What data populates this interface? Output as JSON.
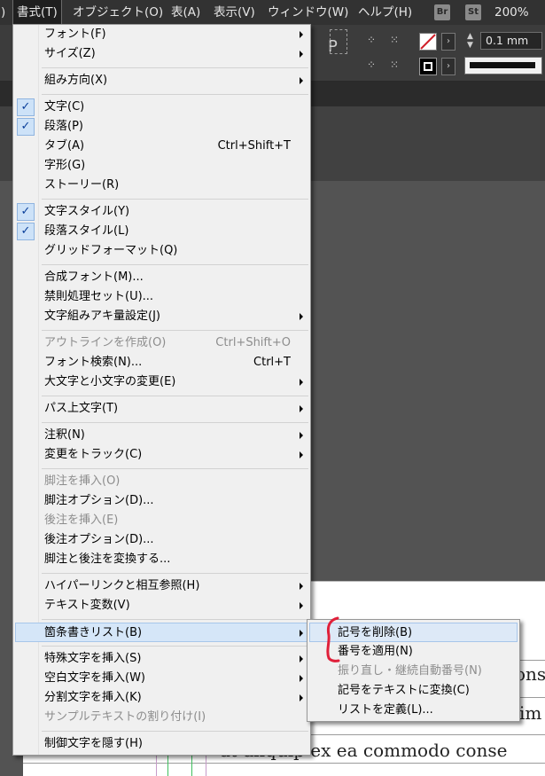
{
  "menubar": {
    "items": [
      {
        "label": ")"
      },
      {
        "label": "書式(T)"
      },
      {
        "label": "オブジェクト(O)"
      },
      {
        "label": "表(A)"
      },
      {
        "label": "表示(V)"
      },
      {
        "label": "ウィンドウ(W)"
      },
      {
        "label": "ヘルプ(H)"
      }
    ],
    "bridge_badge": "Br",
    "stock_badge": "St",
    "zoom": "200%"
  },
  "controlbar": {
    "stroke_weight": "0.1 mm",
    "p_glyph": "P"
  },
  "format_menu": {
    "items": [
      {
        "label": "フォント(F)",
        "submenu": true
      },
      {
        "label": "サイズ(Z)",
        "submenu": true
      },
      {
        "label": "組み方向(X)",
        "submenu": true
      },
      {
        "label": "文字(C)",
        "checked": true
      },
      {
        "label": "段落(P)",
        "checked": true
      },
      {
        "label": "タブ(A)",
        "shortcut": "Ctrl+Shift+T"
      },
      {
        "label": "字形(G)"
      },
      {
        "label": "ストーリー(R)"
      },
      {
        "label": "文字スタイル(Y)",
        "checked": true
      },
      {
        "label": "段落スタイル(L)",
        "checked": true
      },
      {
        "label": "グリッドフォーマット(Q)"
      },
      {
        "label": "合成フォント(M)..."
      },
      {
        "label": "禁則処理セット(U)..."
      },
      {
        "label": "文字組みアキ量設定(J)",
        "submenu": true
      },
      {
        "label": "アウトラインを作成(O)",
        "shortcut": "Ctrl+Shift+O",
        "disabled": true
      },
      {
        "label": "フォント検索(N)...",
        "shortcut": "Ctrl+T"
      },
      {
        "label": "大文字と小文字の変更(E)",
        "submenu": true
      },
      {
        "label": "パス上文字(T)",
        "submenu": true
      },
      {
        "label": "注釈(N)",
        "submenu": true
      },
      {
        "label": "変更をトラック(C)",
        "submenu": true
      },
      {
        "label": "脚注を挿入(O)",
        "disabled": true
      },
      {
        "label": "脚注オプション(D)..."
      },
      {
        "label": "後注を挿入(E)",
        "disabled": true
      },
      {
        "label": "後注オプション(D)..."
      },
      {
        "label": "脚注と後注を変換する..."
      },
      {
        "label": "ハイパーリンクと相互参照(H)",
        "submenu": true
      },
      {
        "label": "テキスト変数(V)",
        "submenu": true
      },
      {
        "label": "箇条書きリスト(B)",
        "submenu": true,
        "highlighted": true
      },
      {
        "label": "特殊文字を挿入(S)",
        "submenu": true
      },
      {
        "label": "空白文字を挿入(W)",
        "submenu": true
      },
      {
        "label": "分割文字を挿入(K)",
        "submenu": true
      },
      {
        "label": "サンプルテキストの割り付け(I)",
        "disabled": true
      },
      {
        "label": "制御文字を隠す(H)"
      }
    ]
  },
  "bullets_submenu": {
    "items": [
      {
        "label": "記号を削除(B)",
        "highlighted": true
      },
      {
        "label": "番号を適用(N)"
      },
      {
        "label": "振り直し・継続自動番号(N)",
        "disabled": true
      },
      {
        "label": "記号をテキストに変換(C)"
      },
      {
        "label": "リストを定義(L)..."
      }
    ]
  },
  "document": {
    "line1": "ons",
    "line2": "im",
    "line3": "at aliquip ex ea commodo conse"
  },
  "colors": {
    "annotation_red": "#e0203a",
    "check_blue": "#0a3f9a"
  }
}
